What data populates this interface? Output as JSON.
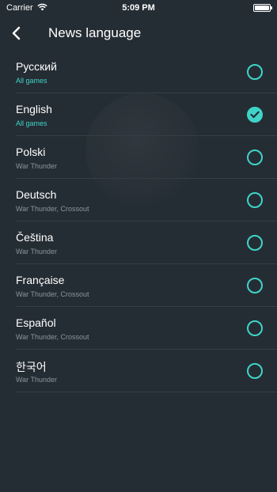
{
  "status_bar": {
    "carrier": "Carrier",
    "time": "5:09 PM"
  },
  "nav": {
    "title": "News language"
  },
  "colors": {
    "accent": "#3fd4c8",
    "background": "#252d34",
    "divider": "#353e46",
    "subtitle": "#8a949c"
  },
  "languages": [
    {
      "name": "Русский",
      "games": "All games",
      "selected": false
    },
    {
      "name": "English",
      "games": "All games",
      "selected": true
    },
    {
      "name": "Polski",
      "games": "War Thunder",
      "selected": false
    },
    {
      "name": "Deutsch",
      "games": "War Thunder, Crossout",
      "selected": false
    },
    {
      "name": "Čeština",
      "games": "War Thunder",
      "selected": false
    },
    {
      "name": "Française",
      "games": "War Thunder, Crossout",
      "selected": false
    },
    {
      "name": "Español",
      "games": "War Thunder, Crossout",
      "selected": false
    },
    {
      "name": "한국어",
      "games": "War Thunder",
      "selected": false
    }
  ]
}
